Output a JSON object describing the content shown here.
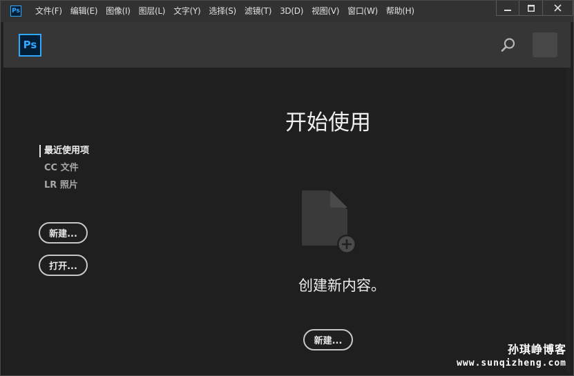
{
  "app": {
    "icon_label": "Ps",
    "accent_color": "#31a8ff"
  },
  "menu": {
    "items": [
      "文件(F)",
      "编辑(E)",
      "图像(I)",
      "图层(L)",
      "文字(Y)",
      "选择(S)",
      "滤镜(T)",
      "3D(D)",
      "视图(V)",
      "窗口(W)",
      "帮助(H)"
    ]
  },
  "window_controls": {
    "minimize": "minimize-icon",
    "maximize": "maximize-icon",
    "close": "close-icon"
  },
  "header": {
    "logo_label": "Ps",
    "search_icon": "search-icon"
  },
  "sidebar": {
    "nav": [
      {
        "label": "最近使用项",
        "active": true
      },
      {
        "label": "CC 文件",
        "active": false
      },
      {
        "label": "LR 照片",
        "active": false
      }
    ],
    "new_button": "新建...",
    "open_button": "打开..."
  },
  "main": {
    "title": "开始使用",
    "create_text": "创建新内容。",
    "new_button": "新建...",
    "doc_icon": "new-document-icon"
  },
  "watermark": {
    "line1": "孙琪峥博客",
    "line2": "www.sunqizheng.com"
  }
}
